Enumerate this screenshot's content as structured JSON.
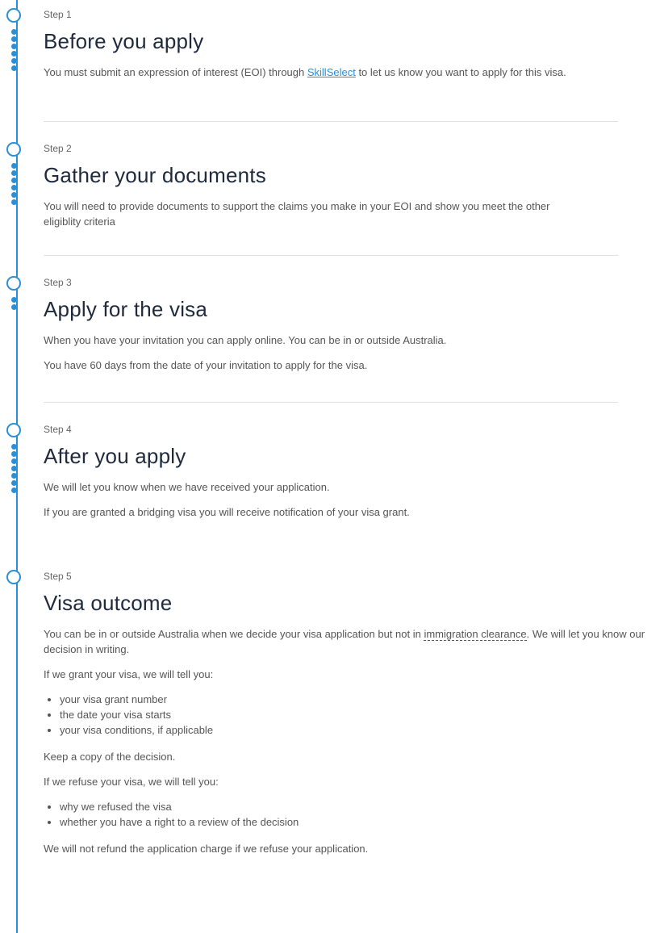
{
  "steps": [
    {
      "label": "Step 1",
      "title": "Before you apply",
      "para1_pre": "You must submit an expression of interest (EOI) through ",
      "para1_link": "SkillSelect",
      "para1_post": " to let us know you want to apply for this visa."
    },
    {
      "label": "Step 2",
      "title": "Gather your documents",
      "para1": "You will need to provide documents to support the claims you make in your EOI and show you meet the other eligiblity criteria"
    },
    {
      "label": "Step 3",
      "title": "Apply for the visa",
      "para1": "When you have your invitation you can apply online. You can be in or outside Australia.",
      "para2": "You have 60 days from the date of your invitation to apply for the visa."
    },
    {
      "label": "Step 4",
      "title": "After you apply",
      "para1": "We will let you know when we have received your application.",
      "para2": "If you are granted a bridging visa you will receive notification of your visa grant."
    },
    {
      "label": "Step 5",
      "title": "Visa outcome",
      "para1_pre": "You can be in or outside Australia when we decide your visa application but not in ",
      "para1_term": "immigration clearance",
      "para1_post": ". We will let you know our decision in writing.",
      "grant_intro": "If we grant your visa, we will tell you:",
      "grant_items": [
        "your visa grant number",
        "the date your visa starts",
        "your visa conditions, if applicable"
      ],
      "keep_copy": "Keep a copy of the decision.",
      "refuse_intro": "If we refuse your visa, we will tell you:",
      "refuse_items": [
        "why we refused the visa",
        "whether you have a right to a review of the decision"
      ],
      "no_refund": "We will not refund the application charge if we refuse your application."
    }
  ],
  "colors": {
    "accent": "#2b8fd6",
    "heading": "#1f2a3c",
    "body": "#555555",
    "divider": "#e1e1e1"
  },
  "icons": {
    "step_marker": "circle-outline-icon",
    "progress": "dot-icon"
  }
}
